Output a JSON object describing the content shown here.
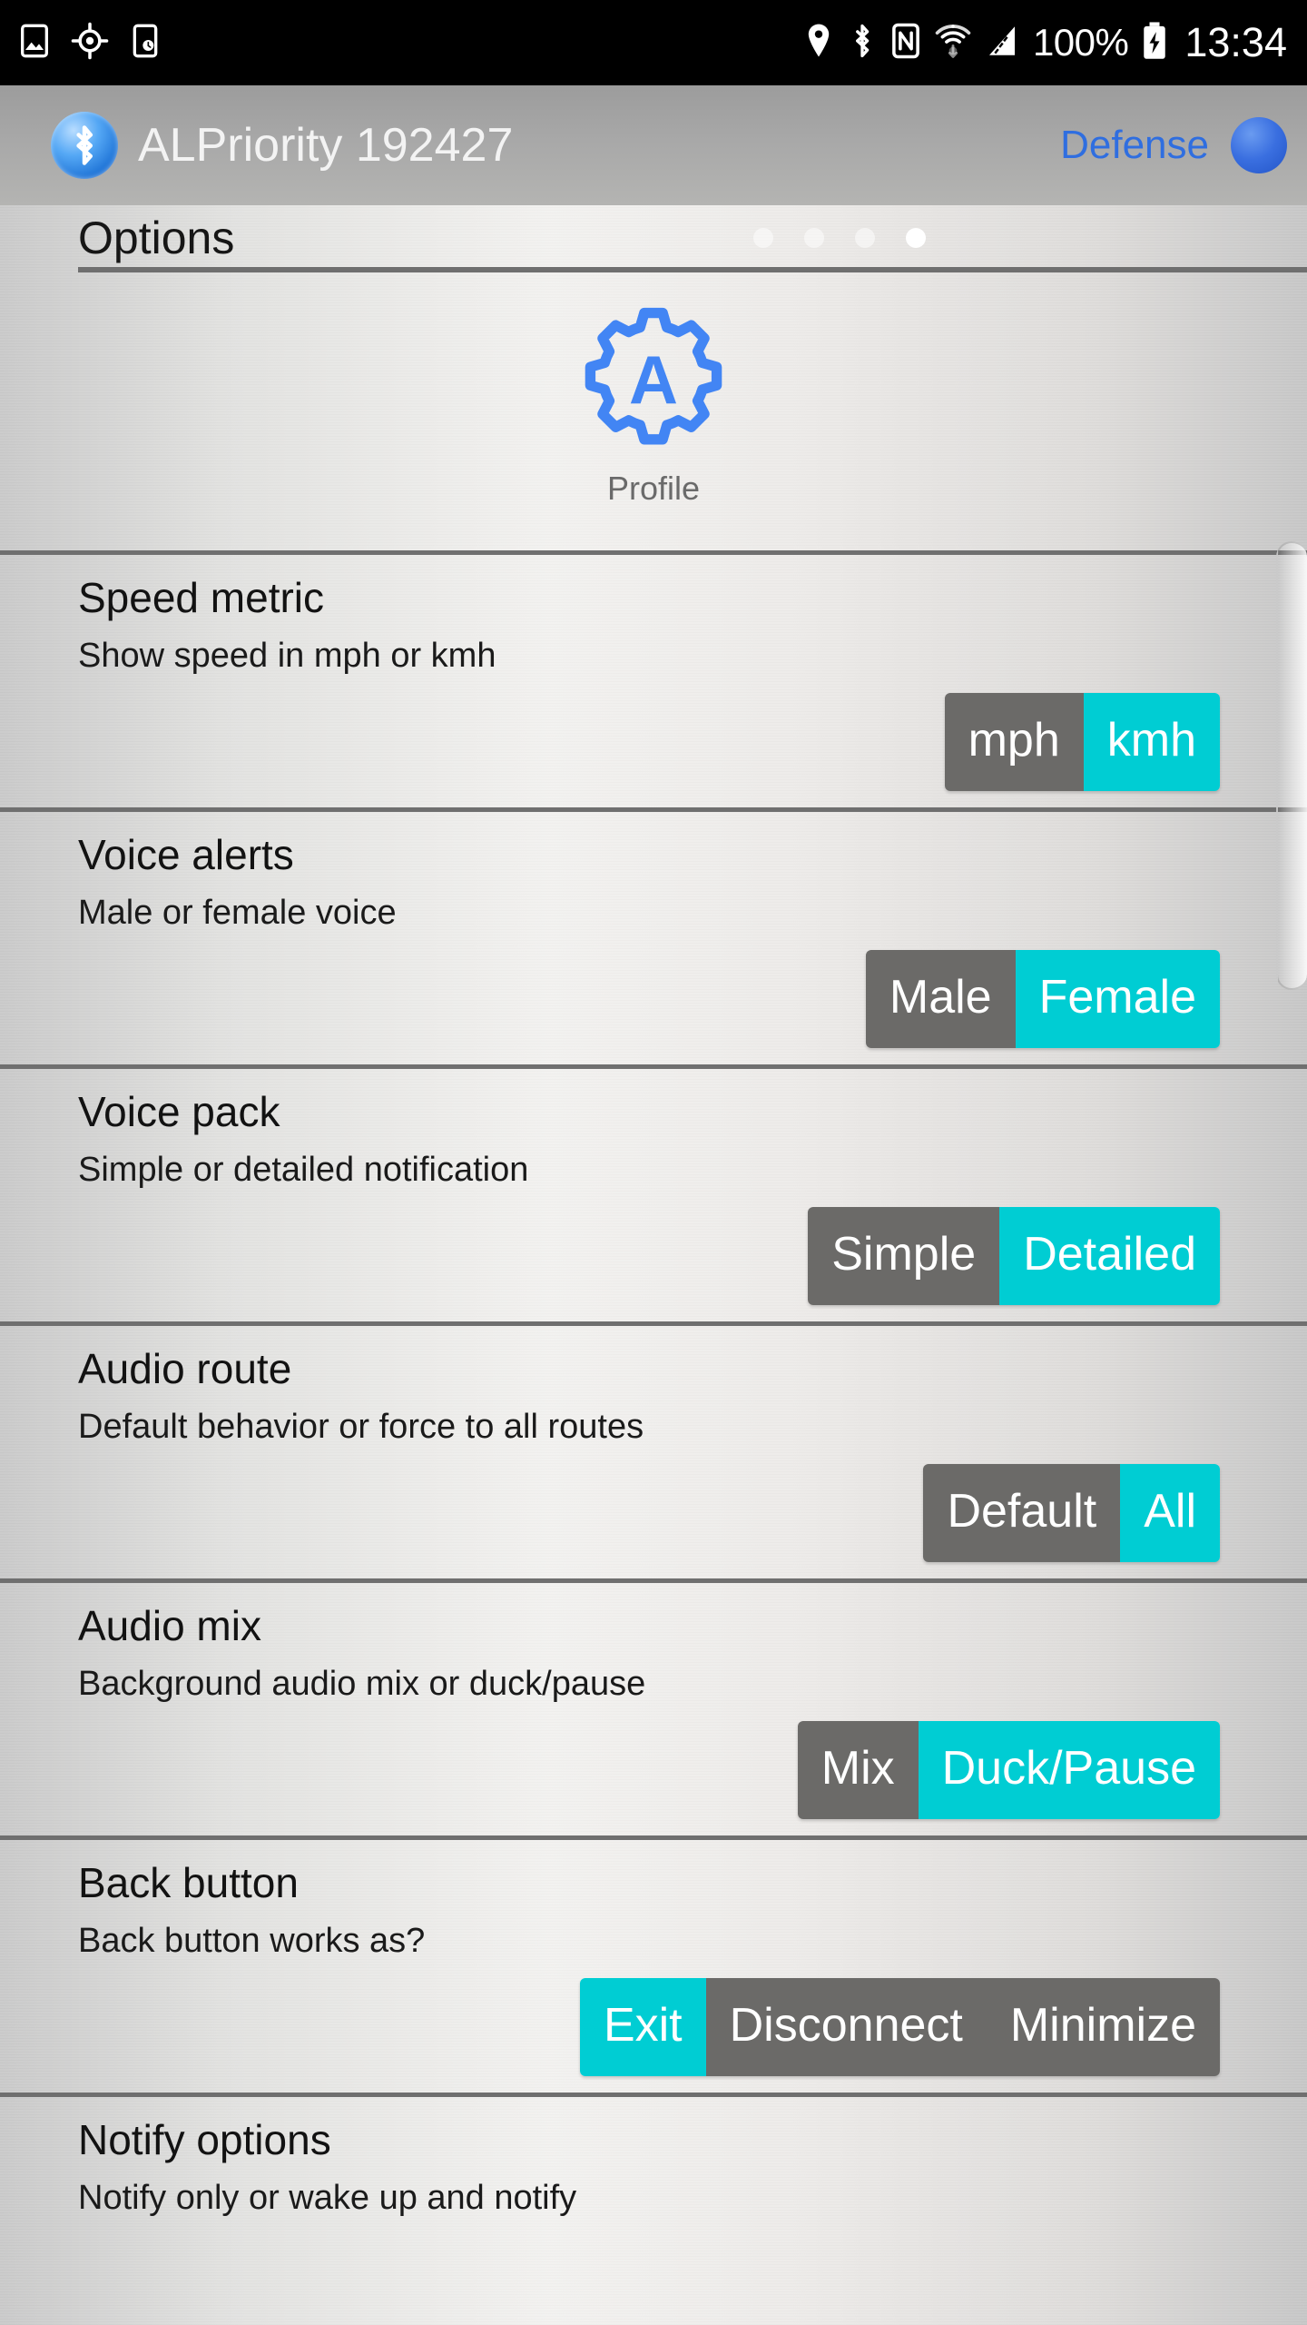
{
  "status_bar": {
    "left_icons": [
      "image-icon",
      "gps-crosshair-icon",
      "device-clock-icon"
    ],
    "right_icons": [
      "location-pin-icon",
      "bluetooth-icon",
      "nfc-icon",
      "wifi-icon",
      "cellular-signal-icon"
    ],
    "battery_percent": "100%",
    "battery_icon": "battery-charging-icon",
    "clock": "13:34"
  },
  "app_bar": {
    "bluetooth_icon": "bluetooth-icon",
    "title": "ALPriority 192427",
    "mode_label": "Defense",
    "status_dot": "connection-status-dot",
    "accent_color": "#2f6ee0"
  },
  "page": {
    "title": "Options",
    "page_indicator": {
      "count": 4,
      "active_index": 3
    }
  },
  "profile": {
    "icon": "gear-profile-icon",
    "letter": "A",
    "label": "Profile",
    "color": "#4285f4"
  },
  "theme": {
    "active_color": "#00cdd3",
    "inactive_color": "#6b6a68",
    "divider_color": "#6f6f6f"
  },
  "settings": [
    {
      "title": "Speed metric",
      "subtitle": "Show speed in mph or kmh",
      "options": [
        {
          "label": "mph",
          "selected": false
        },
        {
          "label": "kmh",
          "selected": true
        }
      ]
    },
    {
      "title": "Voice alerts",
      "subtitle": "Male or female voice",
      "options": [
        {
          "label": "Male",
          "selected": false
        },
        {
          "label": "Female",
          "selected": true
        }
      ]
    },
    {
      "title": "Voice pack",
      "subtitle": "Simple or detailed notification",
      "options": [
        {
          "label": "Simple",
          "selected": false
        },
        {
          "label": "Detailed",
          "selected": true
        }
      ]
    },
    {
      "title": "Audio route",
      "subtitle": "Default behavior or force to all routes",
      "options": [
        {
          "label": "Default",
          "selected": false
        },
        {
          "label": "All",
          "selected": true
        }
      ]
    },
    {
      "title": "Audio mix",
      "subtitle": "Background audio mix or duck/pause",
      "options": [
        {
          "label": "Mix",
          "selected": false
        },
        {
          "label": "Duck/Pause",
          "selected": true
        }
      ]
    },
    {
      "title": "Back button",
      "subtitle": "Back button works as?",
      "options": [
        {
          "label": "Exit",
          "selected": true
        },
        {
          "label": "Disconnect",
          "selected": false
        },
        {
          "label": "Minimize",
          "selected": false
        }
      ]
    },
    {
      "title": "Notify options",
      "subtitle": "Notify only or wake up and notify",
      "options": []
    }
  ]
}
